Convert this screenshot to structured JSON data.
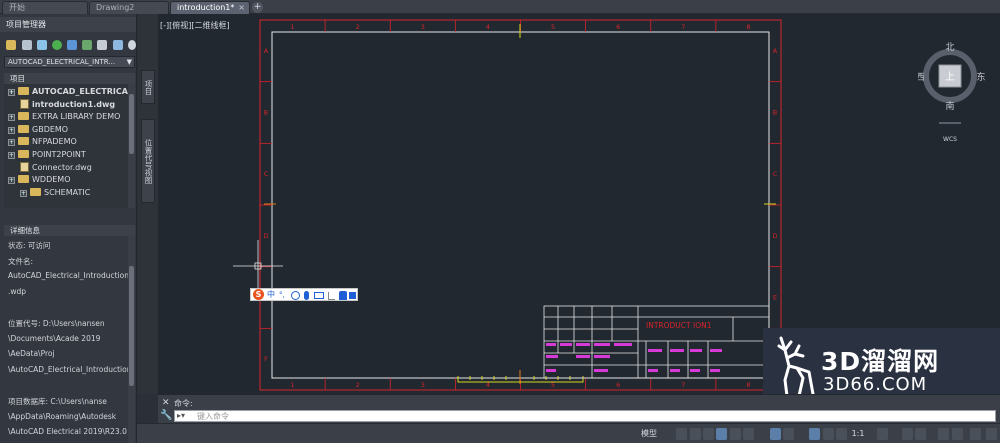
{
  "tabs": [
    {
      "label": "开始"
    },
    {
      "label": "Drawing2"
    },
    {
      "label": "introduction1*"
    }
  ],
  "project_panel": {
    "title": "项目管理器",
    "project_dropdown": "AUTOCAD_ELECTRICAL_INTR...",
    "tree_header": "项目",
    "tree": [
      {
        "label": "AUTOCAD_ELECTRICAL_IN",
        "kind": "folder",
        "bold": true
      },
      {
        "label": "introduction1.dwg",
        "kind": "dwg",
        "bold": true
      },
      {
        "label": "EXTRA LIBRARY DEMO",
        "kind": "folder"
      },
      {
        "label": "GBDEMO",
        "kind": "folder"
      },
      {
        "label": "NFPADEMO",
        "kind": "folder"
      },
      {
        "label": "POINT2POINT",
        "kind": "folder"
      },
      {
        "label": "Connector.dwg",
        "kind": "dwg"
      },
      {
        "label": "WDDEMO",
        "kind": "folder"
      },
      {
        "label": "SCHEMATIC",
        "kind": "folder"
      }
    ],
    "details_title": "详细信息",
    "details": [
      "状态: 可访问",
      "文件名:",
      "AutoCAD_Electrical_Introduction",
      ".wdp",
      "",
      "位置代号: D:\\Users\\nansen",
      "\\Documents\\Acade 2019",
      "\\AeData\\Proj",
      "\\AutoCAD_Electrical_Introduction",
      "",
      "项目数据库: C:\\Users\\nanse",
      "\\AppData\\Roaming\\Autodesk",
      "\\AutoCAD Electrical 2019\\R23.0"
    ]
  },
  "side_tabs": [
    "项目",
    "位置代号视图"
  ],
  "viewport_label": "[-][俯视][二维线框]",
  "viewcube": {
    "north": "北",
    "south": "南",
    "east": "东",
    "west": "西",
    "top": "上",
    "wcs": "WCS"
  },
  "title_block": {
    "title": "INTRODUCT ION1"
  },
  "border_labels": {
    "top": [
      "1",
      "2",
      "3",
      "4",
      "5",
      "6",
      "7",
      "8"
    ],
    "bottom": [
      "1",
      "2",
      "3",
      "4",
      "5",
      "6",
      "7",
      "8"
    ],
    "left": [
      "A",
      "B",
      "C",
      "D",
      "E",
      "F"
    ],
    "right": [
      "A",
      "B",
      "C",
      "D",
      "E",
      "F"
    ]
  },
  "ime_bar": {
    "logo": "S",
    "mode": "中",
    "punct": "°,"
  },
  "watermark": {
    "title": "3D溜溜网",
    "subtitle": "3D66.COM"
  },
  "command": {
    "history": "命令:",
    "placeholder": "键入命令"
  },
  "statusbar": {
    "model": "模型",
    "scale": "1:1"
  },
  "colors": {
    "border_red": "#d8232a",
    "frame_white": "#e8e8e8",
    "magenta": "#d83ad8",
    "yellow": "#d6d61a",
    "canvas_bg": "#212830"
  }
}
